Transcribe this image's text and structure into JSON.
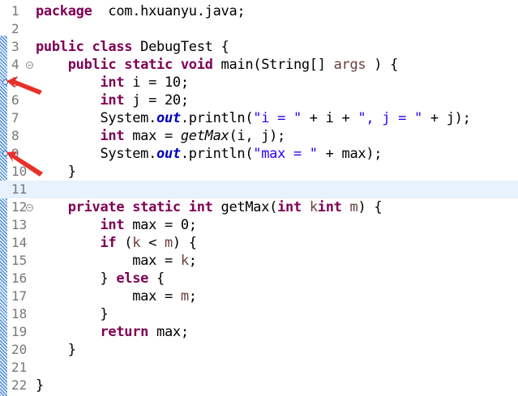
{
  "editor": {
    "current_line": 11,
    "breakpoint_lines": [
      5,
      9
    ],
    "fold_lines": [
      4,
      12
    ],
    "fold_icon": "collapse-icon",
    "colors": {
      "keyword": "#7f0055",
      "string": "#2a00ff",
      "static_field": "#0000c0",
      "parameter": "#6a3e3e",
      "line_number": "#787878",
      "current_line_bg": "#e8f2fe",
      "annotation_arrow": "#e8302a"
    },
    "lines": [
      {
        "n": "1",
        "tokens": [
          [
            "kw",
            "package"
          ],
          [
            "",
            "  com.hxuanyu.java;"
          ]
        ]
      },
      {
        "n": "2",
        "tokens": []
      },
      {
        "n": "3",
        "tokens": [
          [
            "kw",
            "public"
          ],
          [
            "",
            " "
          ],
          [
            "kw",
            "class"
          ],
          [
            "",
            " DebugTest {"
          ]
        ]
      },
      {
        "n": "4",
        "tokens": [
          [
            "",
            "    "
          ],
          [
            "kw",
            "public"
          ],
          [
            "",
            " "
          ],
          [
            "kw",
            "static"
          ],
          [
            "",
            " "
          ],
          [
            "kw",
            "void"
          ],
          [
            "",
            " main(String[] "
          ],
          [
            "param",
            "args"
          ],
          [
            "",
            " ) {"
          ]
        ]
      },
      {
        "n": "5",
        "tokens": [
          [
            "",
            "        "
          ],
          [
            "kw",
            "int"
          ],
          [
            "",
            " i = 10;"
          ]
        ]
      },
      {
        "n": "6",
        "tokens": [
          [
            "",
            "        "
          ],
          [
            "kw",
            "int"
          ],
          [
            "",
            " j = 20;"
          ]
        ]
      },
      {
        "n": "7",
        "tokens": [
          [
            "",
            "        System."
          ],
          [
            "fld",
            "out"
          ],
          [
            "",
            ".println("
          ],
          [
            "str",
            "\"i = \""
          ],
          [
            "",
            " + i + "
          ],
          [
            "str",
            "\", j = \""
          ],
          [
            "",
            " + j);"
          ]
        ]
      },
      {
        "n": "8",
        "tokens": [
          [
            "",
            "        "
          ],
          [
            "kw",
            "int"
          ],
          [
            "",
            " max = "
          ],
          [
            "mcall",
            "getMax"
          ],
          [
            "",
            "(i, j);"
          ]
        ]
      },
      {
        "n": "9",
        "tokens": [
          [
            "",
            "        System."
          ],
          [
            "fld",
            "out"
          ],
          [
            "",
            ".println("
          ],
          [
            "str",
            "\"max = \""
          ],
          [
            "",
            " + max);"
          ]
        ]
      },
      {
        "n": "10",
        "tokens": [
          [
            "",
            "    }"
          ]
        ]
      },
      {
        "n": "11",
        "tokens": []
      },
      {
        "n": "12",
        "tokens": [
          [
            "",
            "    "
          ],
          [
            "kw",
            "private"
          ],
          [
            "",
            " "
          ],
          [
            "kw",
            "static"
          ],
          [
            "",
            " "
          ],
          [
            "kw",
            "int"
          ],
          [
            "",
            " getMax("
          ],
          [
            "kw",
            "int"
          ],
          [
            "",
            " "
          ],
          [
            "param",
            "k"
          ],
          [
            ", "
          ],
          [
            "kw",
            "int"
          ],
          [
            "",
            " "
          ],
          [
            "param",
            "m"
          ],
          [
            "",
            ") {"
          ]
        ]
      },
      {
        "n": "13",
        "tokens": [
          [
            "",
            "        "
          ],
          [
            "kw",
            "int"
          ],
          [
            "",
            " max = 0;"
          ]
        ]
      },
      {
        "n": "14",
        "tokens": [
          [
            "",
            "        "
          ],
          [
            "kw",
            "if"
          ],
          [
            "",
            " ("
          ],
          [
            "param",
            "k"
          ],
          [
            "",
            " < "
          ],
          [
            "param",
            "m"
          ],
          [
            "",
            ") {"
          ]
        ]
      },
      {
        "n": "15",
        "tokens": [
          [
            "",
            "            max = "
          ],
          [
            "param",
            "k"
          ],
          [
            "",
            ";"
          ]
        ]
      },
      {
        "n": "16",
        "tokens": [
          [
            "",
            "        } "
          ],
          [
            "kw",
            "else"
          ],
          [
            "",
            " {"
          ]
        ]
      },
      {
        "n": "17",
        "tokens": [
          [
            "",
            "            max = "
          ],
          [
            "param",
            "m"
          ],
          [
            "",
            ";"
          ]
        ]
      },
      {
        "n": "18",
        "tokens": [
          [
            "",
            "        }"
          ]
        ]
      },
      {
        "n": "19",
        "tokens": [
          [
            "",
            "        "
          ],
          [
            "kw",
            "return"
          ],
          [
            "",
            " max;"
          ]
        ]
      },
      {
        "n": "20",
        "tokens": [
          [
            "",
            "    }"
          ]
        ]
      },
      {
        "n": "21",
        "tokens": []
      },
      {
        "n": "22",
        "tokens": [
          [
            "",
            "}"
          ]
        ]
      }
    ]
  }
}
